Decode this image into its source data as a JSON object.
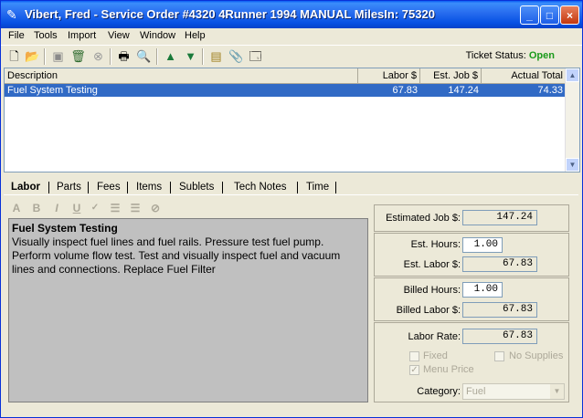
{
  "window": {
    "title": "Vibert, Fred - Service Order #4320  4Runner 1994 MANUAL  MilesIn: 75320",
    "minimize": "_",
    "maximize": "□",
    "close": "×"
  },
  "menu": [
    "File",
    "Tools",
    "Import",
    "View",
    "Window",
    "Help"
  ],
  "toolbar": {
    "icons": [
      "new-icon",
      "open-icon",
      "save-icon",
      "delete-icon",
      "cancel-icon",
      "print-icon",
      "print-preview-icon",
      "move-up-icon",
      "move-down-icon",
      "calculator-icon",
      "attach-icon",
      "properties-icon"
    ],
    "ticket_status_label": "Ticket Status:",
    "ticket_status_value": "Open"
  },
  "list": {
    "columns": [
      "Description",
      "Labor $",
      "Est. Job $",
      "Actual Total"
    ],
    "rows": [
      {
        "description": "Fuel System Testing",
        "labor": "67.83",
        "est_job": "147.24",
        "actual_total": "74.33"
      }
    ]
  },
  "tabs": [
    "Labor",
    "Parts",
    "Fees",
    "Items",
    "Sublets",
    "Tech Notes",
    "Time"
  ],
  "editor": {
    "tools": [
      "A",
      "B",
      "I",
      "U"
    ],
    "title": "Fuel System Testing",
    "body": "Visually inspect fuel lines and fuel rails. Pressure test fuel pump. Perform volume flow test. Test and visually inspect fuel and vacuum lines and connections.  Replace Fuel Filter"
  },
  "fields": {
    "estimated_job_label": "Estimated Job $:",
    "estimated_job": "147.24",
    "est_hours_label": "Est. Hours:",
    "est_hours": "1.00",
    "est_labor_label": "Est. Labor $:",
    "est_labor": "67.83",
    "billed_hours_label": "Billed Hours:",
    "billed_hours": "1.00",
    "billed_labor_label": "Billed Labor $:",
    "billed_labor": "67.83",
    "labor_rate_label": "Labor Rate:",
    "labor_rate": "67.83",
    "fixed_label": "Fixed",
    "no_supplies_label": "No Supplies",
    "menu_price_label": "Menu Price",
    "category_label": "Category:",
    "category_value": "Fuel"
  }
}
